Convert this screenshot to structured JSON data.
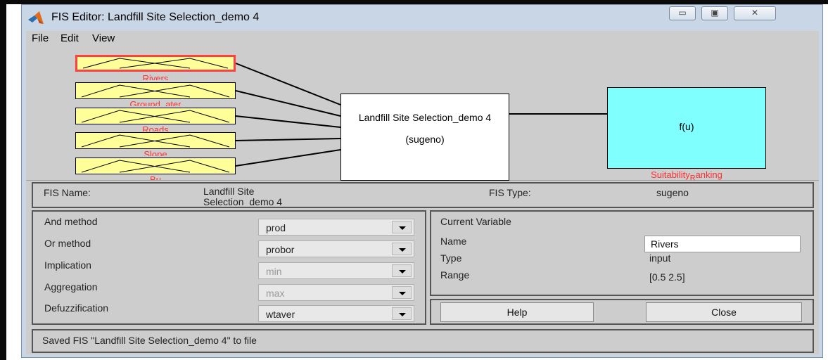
{
  "window": {
    "title": "FIS Editor: Landfill Site Selection_demo 4",
    "controls": {
      "minimize": "▭",
      "maximize": "▣",
      "close": "✕"
    }
  },
  "menu": [
    "File",
    "Edit",
    "View"
  ],
  "diagram": {
    "inputs": [
      "Rivers",
      "Ground_ater",
      "Roads",
      "Slope",
      "Bu"
    ],
    "system_name": "Landfill Site Selection_demo 4",
    "system_type": "(sugeno)",
    "output_func": "f(u)",
    "output_label_before": "Suitability",
    "output_label_sub": "R",
    "output_label_after": "anking"
  },
  "fis_info": {
    "name_label": "FIS Name:",
    "name_value_1": "Landfill Site",
    "name_value_2": "Selection_demo 4",
    "type_label": "FIS Type:",
    "type_value": "sugeno"
  },
  "methods": [
    {
      "label": "And method",
      "value": "prod",
      "enabled": true
    },
    {
      "label": "Or method",
      "value": "probor",
      "enabled": true
    },
    {
      "label": "Implication",
      "value": "min",
      "enabled": false
    },
    {
      "label": "Aggregation",
      "value": "max",
      "enabled": false
    },
    {
      "label": "Defuzzification",
      "value": "wtaver",
      "enabled": true
    }
  ],
  "current_variable": {
    "heading": "Current Variable",
    "name_label": "Name",
    "name_value": "Rivers",
    "type_label": "Type",
    "type_value": "input",
    "range_label": "Range",
    "range_value": "[0.5 2.5]"
  },
  "buttons": {
    "help": "Help",
    "close": "Close"
  },
  "status": "Saved FIS \"Landfill Site Selection_demo 4\" to file",
  "colors": {
    "input_fill": "#ffff99",
    "output_fill": "#80ffff",
    "selected_border": "#ff4040",
    "label_red": "#ff3030"
  }
}
